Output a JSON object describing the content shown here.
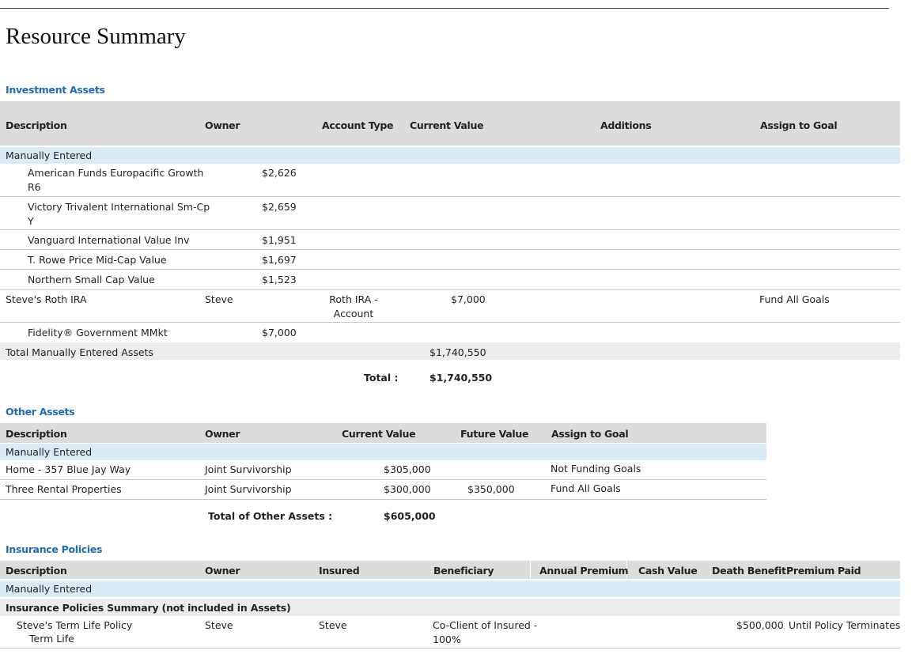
{
  "page_title": "Resource Summary",
  "investment": {
    "title": "Investment Assets",
    "headers": {
      "description": "Description",
      "owner": "Owner",
      "account_type": "Account Type",
      "current_value": "Current Value",
      "additions": "Additions",
      "assign_to_goal": "Assign to Goal"
    },
    "group_label": "Manually Entered",
    "holdings": [
      {
        "name": "American Funds Europacific Growth R6",
        "value": "$2,626"
      },
      {
        "name": "Victory Trivalent International Sm-Cp Y",
        "value": "$2,659"
      },
      {
        "name": "Vanguard International Value Inv",
        "value": "$1,951"
      },
      {
        "name": "T. Rowe Price Mid-Cap Value",
        "value": "$1,697"
      },
      {
        "name": "Northern Small Cap Value",
        "value": "$1,523"
      }
    ],
    "account": {
      "name": "Steve's Roth IRA",
      "owner": "Steve",
      "account_type": "Roth IRA - Account",
      "current_value": "$7,000",
      "goal": "Fund All Goals",
      "holding": {
        "name": "Fidelity® Government MMkt",
        "value": "$7,000"
      }
    },
    "total_row": {
      "label": "Total Manually Entered Assets",
      "value": "$1,740,550"
    },
    "grand_total": {
      "label": "Total :",
      "value": "$1,740,550"
    }
  },
  "other": {
    "title": "Other Assets",
    "headers": {
      "description": "Description",
      "owner": "Owner",
      "current_value": "Current Value",
      "future_value": "Future Value",
      "assign_to_goal": "Assign to Goal"
    },
    "group_label": "Manually Entered",
    "rows": [
      {
        "description": "Home - 357 Blue Jay Way",
        "owner": "Joint Survivorship",
        "current_value": "$305,000",
        "future_value": "",
        "goal": "Not Funding Goals"
      },
      {
        "description": "Three Rental Properties",
        "owner": "Joint Survivorship",
        "current_value": "$300,000",
        "future_value": "$350,000",
        "goal": "Fund All Goals"
      }
    ],
    "total": {
      "label": "Total of Other Assets :",
      "value": "$605,000"
    }
  },
  "insurance": {
    "title": "Insurance Policies",
    "headers": {
      "description": "Description",
      "owner": "Owner",
      "insured": "Insured",
      "beneficiary": "Beneficiary",
      "annual_premium": "Annual Premium",
      "cash_value": "Cash Value",
      "death_benefit": "Death Benefit",
      "premium_paid": "Premium Paid"
    },
    "group_label": "Manually Entered",
    "summary_label": "Insurance Policies Summary (not included in Assets)",
    "rows": [
      {
        "name": "Steve's Term Life Policy",
        "type": "Term Life",
        "owner": "Steve",
        "insured": "Steve",
        "beneficiary": "Co-Client of Insured - 100%",
        "death_benefit": "$500,000",
        "premium_paid": "Until Policy Terminates"
      }
    ]
  }
}
